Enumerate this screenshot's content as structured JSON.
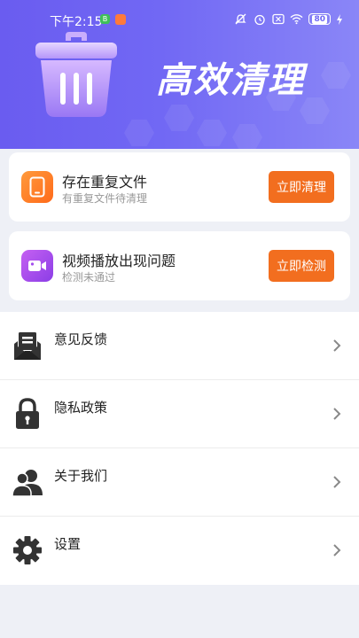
{
  "status_bar": {
    "time": "下午2:15",
    "app1_glyph": "B",
    "battery": "80",
    "icons": [
      "mute-icon",
      "alarm-icon",
      "sim-off-icon",
      "wifi-icon",
      "battery-icon",
      "charging-icon"
    ]
  },
  "header": {
    "title": "高效清理",
    "icon": "trash-icon"
  },
  "cards": [
    {
      "icon": "phone-icon",
      "title": "存在重复文件",
      "subtitle": "有重复文件待清理",
      "button": "立即清理"
    },
    {
      "icon": "video-icon",
      "title": "视频播放出现问题",
      "subtitle": "检测未通过",
      "button": "立即检测"
    }
  ],
  "menu": [
    {
      "icon": "feedback-mail-icon",
      "label": "意见反馈"
    },
    {
      "icon": "lock-icon",
      "label": "隐私政策"
    },
    {
      "icon": "users-icon",
      "label": "关于我们"
    },
    {
      "icon": "gear-icon",
      "label": "设置"
    }
  ],
  "colors": {
    "header_gradient_start": "#6a5cf0",
    "header_gradient_end": "#8a86f7",
    "button": "#f26e1f",
    "background": "#eef0f6"
  }
}
